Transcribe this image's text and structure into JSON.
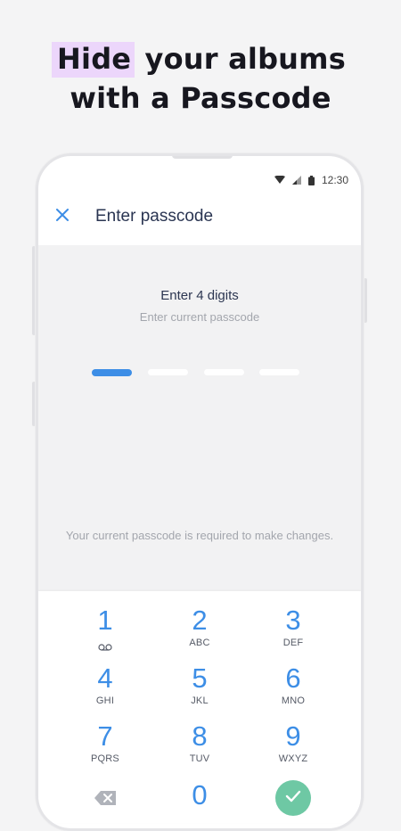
{
  "headline": {
    "highlight": "Hide",
    "rest_line1": " your albums",
    "line2": "with a Passcode"
  },
  "status_bar": {
    "time": "12:30",
    "icons": [
      "wifi-icon",
      "signal-icon",
      "battery-icon"
    ]
  },
  "app_bar": {
    "close_icon": "close-icon",
    "title": "Enter passcode"
  },
  "prompt": {
    "title": "Enter 4 digits",
    "subtitle": "Enter current passcode"
  },
  "passcode": {
    "length": 4,
    "entered": 0,
    "active_index": 0
  },
  "notice": "Your current passcode is required to make changes.",
  "keypad": {
    "keys": [
      {
        "digit": "1",
        "letters": ""
      },
      {
        "digit": "2",
        "letters": "ABC"
      },
      {
        "digit": "3",
        "letters": "DEF"
      },
      {
        "digit": "4",
        "letters": "GHI"
      },
      {
        "digit": "5",
        "letters": "JKL"
      },
      {
        "digit": "6",
        "letters": "MNO"
      },
      {
        "digit": "7",
        "letters": "PQRS"
      },
      {
        "digit": "8",
        "letters": "TUV"
      },
      {
        "digit": "9",
        "letters": "WXYZ"
      },
      {
        "digit": "0",
        "letters": ""
      }
    ],
    "backspace_icon": "backspace-icon",
    "confirm_icon": "checkmark-icon"
  },
  "colors": {
    "accent": "#3d8ee6",
    "confirm": "#6ec8a4",
    "highlight": "#ecd6fb"
  }
}
